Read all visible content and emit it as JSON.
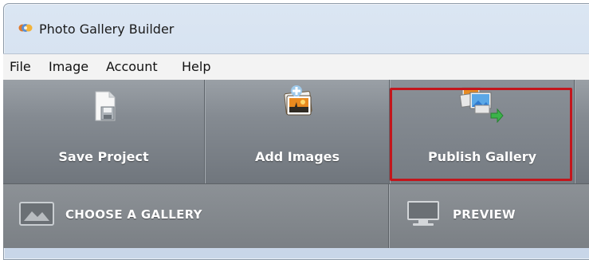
{
  "window": {
    "title": "Photo Gallery Builder"
  },
  "menu": {
    "items": [
      "File",
      "Image",
      "Account",
      "Help"
    ]
  },
  "toolbar": {
    "buttons": [
      {
        "label": "Save Project",
        "icon": "save-project-icon"
      },
      {
        "label": "Add Images",
        "icon": "add-images-icon"
      },
      {
        "label": "Publish Gallery",
        "icon": "publish-gallery-icon",
        "highlighted": true
      }
    ]
  },
  "steps": {
    "items": [
      {
        "label": "CHOOSE A GALLERY",
        "icon": "gallery-image-icon"
      },
      {
        "label": "PREVIEW",
        "icon": "monitor-icon"
      }
    ]
  },
  "colors": {
    "highlight_border": "#c3161c",
    "toolbar_bg": "#858b92"
  }
}
